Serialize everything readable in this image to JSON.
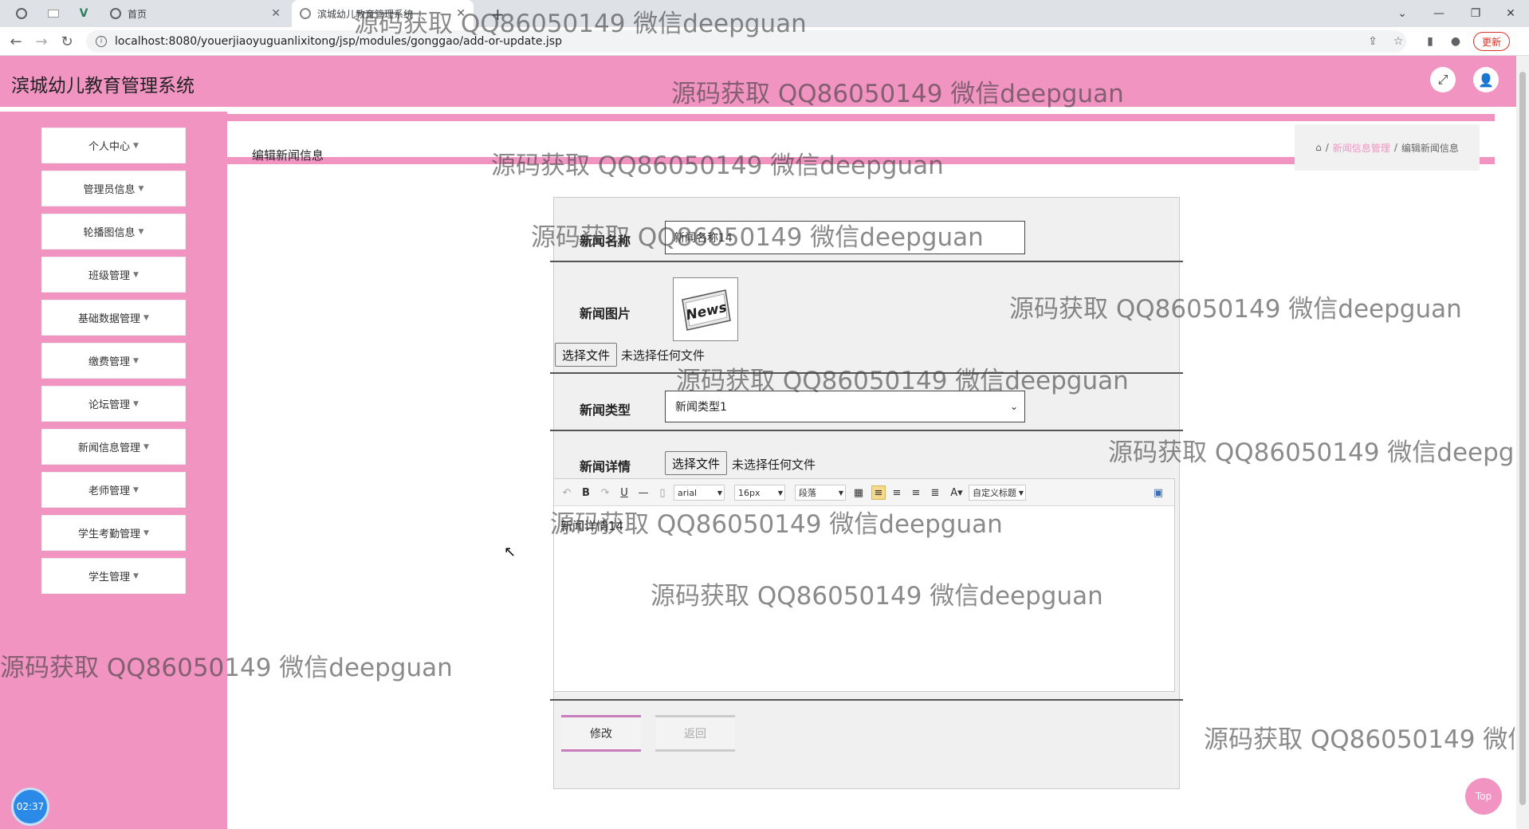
{
  "browser": {
    "tabs": [
      {
        "title": "首页"
      },
      {
        "title": "滨城幼儿教育管理系统"
      }
    ],
    "new_tab": "+",
    "url": "localhost:8080/youerjiaoyuguanlixitong/jsp/modules/gonggao/add-or-update.jsp",
    "update_label": "更新"
  },
  "app": {
    "title": "滨城幼儿教育管理系统"
  },
  "sidebar": {
    "items": [
      {
        "label": "个人中心"
      },
      {
        "label": "管理员信息"
      },
      {
        "label": "轮播图信息"
      },
      {
        "label": "班级管理"
      },
      {
        "label": "基础数据管理"
      },
      {
        "label": "缴费管理"
      },
      {
        "label": "论坛管理"
      },
      {
        "label": "新闻信息管理"
      },
      {
        "label": "老师管理"
      },
      {
        "label": "学生考勤管理"
      },
      {
        "label": "学生管理"
      }
    ],
    "clock": "02:37"
  },
  "page": {
    "heading": "编辑新闻信息",
    "breadcrumb": {
      "parent": "新闻信息管理",
      "separator": "/",
      "current": "编辑新闻信息"
    }
  },
  "form": {
    "name_label": "新闻名称",
    "name_value": "新闻名称14",
    "image_label": "新闻图片",
    "image_alt": "News",
    "choose_file": "选择文件",
    "no_file": "未选择任何文件",
    "type_label": "新闻类型",
    "type_value": "新闻类型1",
    "detail_label": "新闻详情",
    "editor": {
      "font": "arial",
      "size": "16px",
      "paragraph": "段落",
      "custom_title": "自定义标题",
      "body": "新闻详情14"
    },
    "submit": "修改",
    "back": "返回"
  },
  "top_button": "Top",
  "watermark": "源码获取 QQ86050149 微信deepguan"
}
